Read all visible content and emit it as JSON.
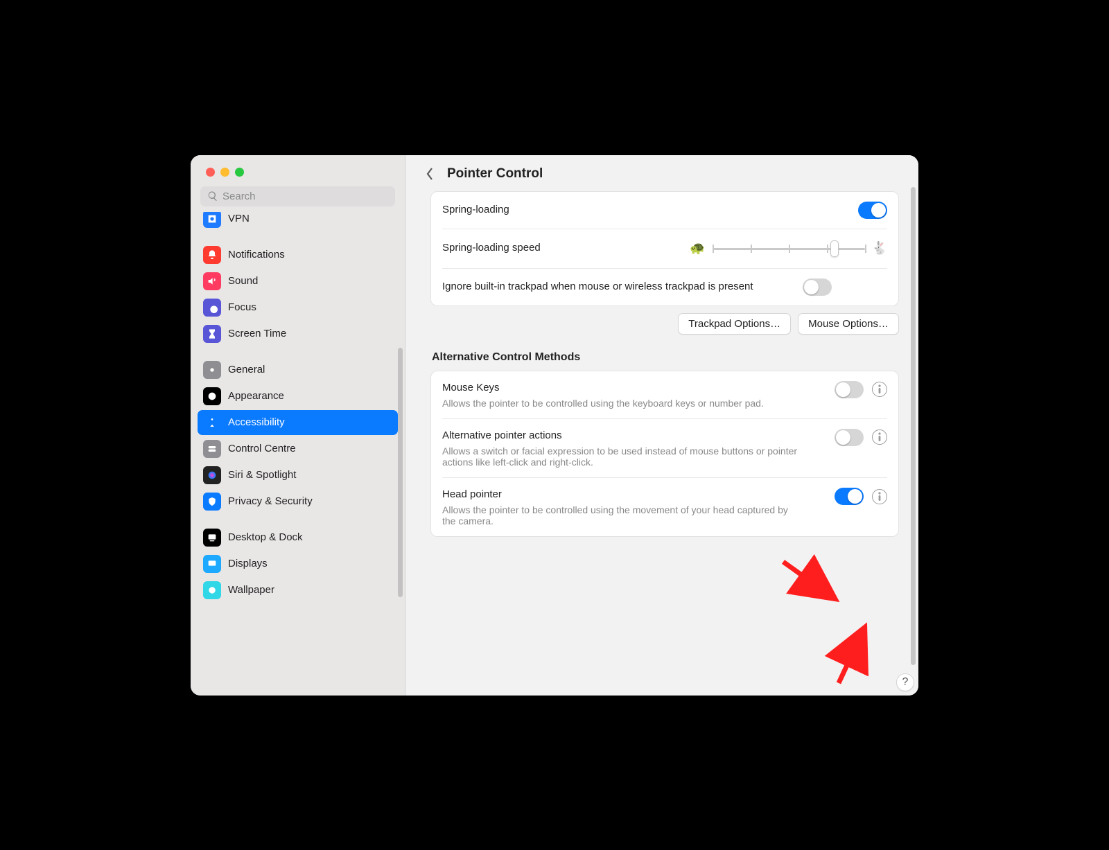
{
  "header": {
    "title": "Pointer Control"
  },
  "search": {
    "placeholder": "Search"
  },
  "sidebar": {
    "items": [
      {
        "label": "VPN",
        "color": "#1f7bff"
      },
      {
        "gap": true
      },
      {
        "label": "Notifications",
        "color": "#ff3b30"
      },
      {
        "label": "Sound",
        "color": "#ff3b62"
      },
      {
        "label": "Focus",
        "color": "#5856d6"
      },
      {
        "label": "Screen Time",
        "color": "#5856d6"
      },
      {
        "gap": true
      },
      {
        "label": "General",
        "color": "#8e8e93"
      },
      {
        "label": "Appearance",
        "color": "#000000"
      },
      {
        "label": "Accessibility",
        "color": "#0a7aff",
        "selected": true
      },
      {
        "label": "Control Centre",
        "color": "#8e8e93"
      },
      {
        "label": "Siri & Spotlight",
        "color": "#222"
      },
      {
        "label": "Privacy & Security",
        "color": "#0a7aff"
      },
      {
        "gap": true
      },
      {
        "label": "Desktop & Dock",
        "color": "#000000"
      },
      {
        "label": "Displays",
        "color": "#1da9ff"
      },
      {
        "label": "Wallpaper",
        "color": "#2fd7e7"
      }
    ]
  },
  "settings": {
    "spring_loading": {
      "label": "Spring-loading",
      "on": true
    },
    "spring_speed": {
      "label": "Spring-loading speed",
      "value": 0.82
    },
    "ignore_trackpad": {
      "label": "Ignore built-in trackpad when mouse or wireless trackpad is present",
      "on": false
    }
  },
  "buttons": {
    "trackpad": "Trackpad Options…",
    "mouse": "Mouse Options…"
  },
  "alt_section": {
    "heading": "Alternative Control Methods",
    "mouse_keys": {
      "label": "Mouse Keys",
      "desc": "Allows the pointer to be controlled using the keyboard keys or number pad.",
      "on": false
    },
    "alt_pointer": {
      "label": "Alternative pointer actions",
      "desc": "Allows a switch or facial expression to be used instead of mouse buttons or pointer actions like left-click and right-click.",
      "on": false
    },
    "head_pointer": {
      "label": "Head pointer",
      "desc": "Allows the pointer to be controlled using the movement of your head captured by the camera.",
      "on": true
    }
  },
  "help": "?"
}
